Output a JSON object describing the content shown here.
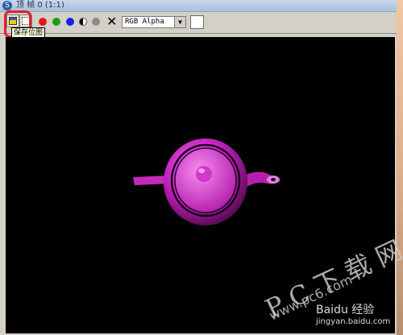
{
  "window": {
    "title": "顶 帧 0 (1:1)"
  },
  "toolbar": {
    "tooltip": "保存位图",
    "channel_select": {
      "selected": "RGB Alpha"
    },
    "color_buttons": [
      "red",
      "green",
      "blue"
    ],
    "icons": [
      "save-bitmap-icon",
      "clone-icon",
      "alpha-toggle-icon",
      "mono-icon",
      "clear-icon"
    ]
  },
  "watermark": {
    "pc_text": "P C 下 载 网",
    "site_text": "www.pc6.com",
    "baidu_text": "Baidu 经验",
    "baidu_sub": "jingyan.baidu.com"
  },
  "colors": {
    "highlight": "#e4202c",
    "teapot": "#d020c8",
    "viewport_bg": "#000000"
  }
}
